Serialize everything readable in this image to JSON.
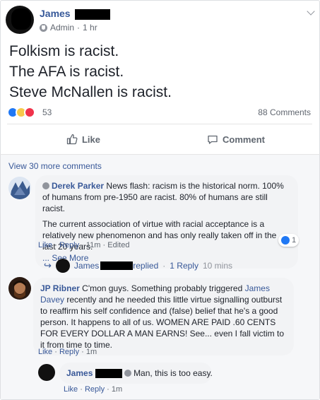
{
  "post": {
    "author_name": "James",
    "role": "Admin",
    "time": "1 hr",
    "lines": [
      "Folkism is racist.",
      "The AFA is racist.",
      "Steve McNallen is racist."
    ],
    "reaction_count": "53",
    "comment_count": "88 Comments"
  },
  "actions": {
    "like": "Like",
    "comment": "Comment"
  },
  "view_more": "View 30 more comments",
  "comments": [
    {
      "author": "Derek Parker",
      "text1": "News flash: racism is the historical norm. 100% of humans from pre-1950 are racist. 80% of humans are still racist.",
      "text2": "The current association of virtue with racial acceptance is a relatively new phenomenon and has only really taken off in the last 20 years.",
      "see_more": "... See More",
      "like": "Like",
      "reply": "Reply",
      "time": "11m",
      "edited": "Edited",
      "likes": "1"
    },
    {
      "reply_author": "James",
      "replied": "replied",
      "reply_count": "1 Reply",
      "reply_time": "10 mins"
    },
    {
      "author": "JP Ribner",
      "text_a": "C'mon guys. Something probably triggered",
      "mention": "James Davey",
      "text_b": "recently and he needed this little virtue signalling outburst to reaffirm his self confidence and (false) belief that he's a good person. It happens to all of us. WOMEN ARE PAID .60 CENTS FOR EVERY DOLLAR A MAN EARNS! See... even I fall victim to it from time to time.",
      "like": "Like",
      "reply": "Reply",
      "time": "1m"
    },
    {
      "author": "James",
      "text": "Man, this is too easy.",
      "like": "Like",
      "reply": "Reply",
      "time": "1m"
    }
  ],
  "colors": {
    "link": "#385898",
    "like_blue": "#2078f4",
    "bubble": "#f2f3f5"
  }
}
